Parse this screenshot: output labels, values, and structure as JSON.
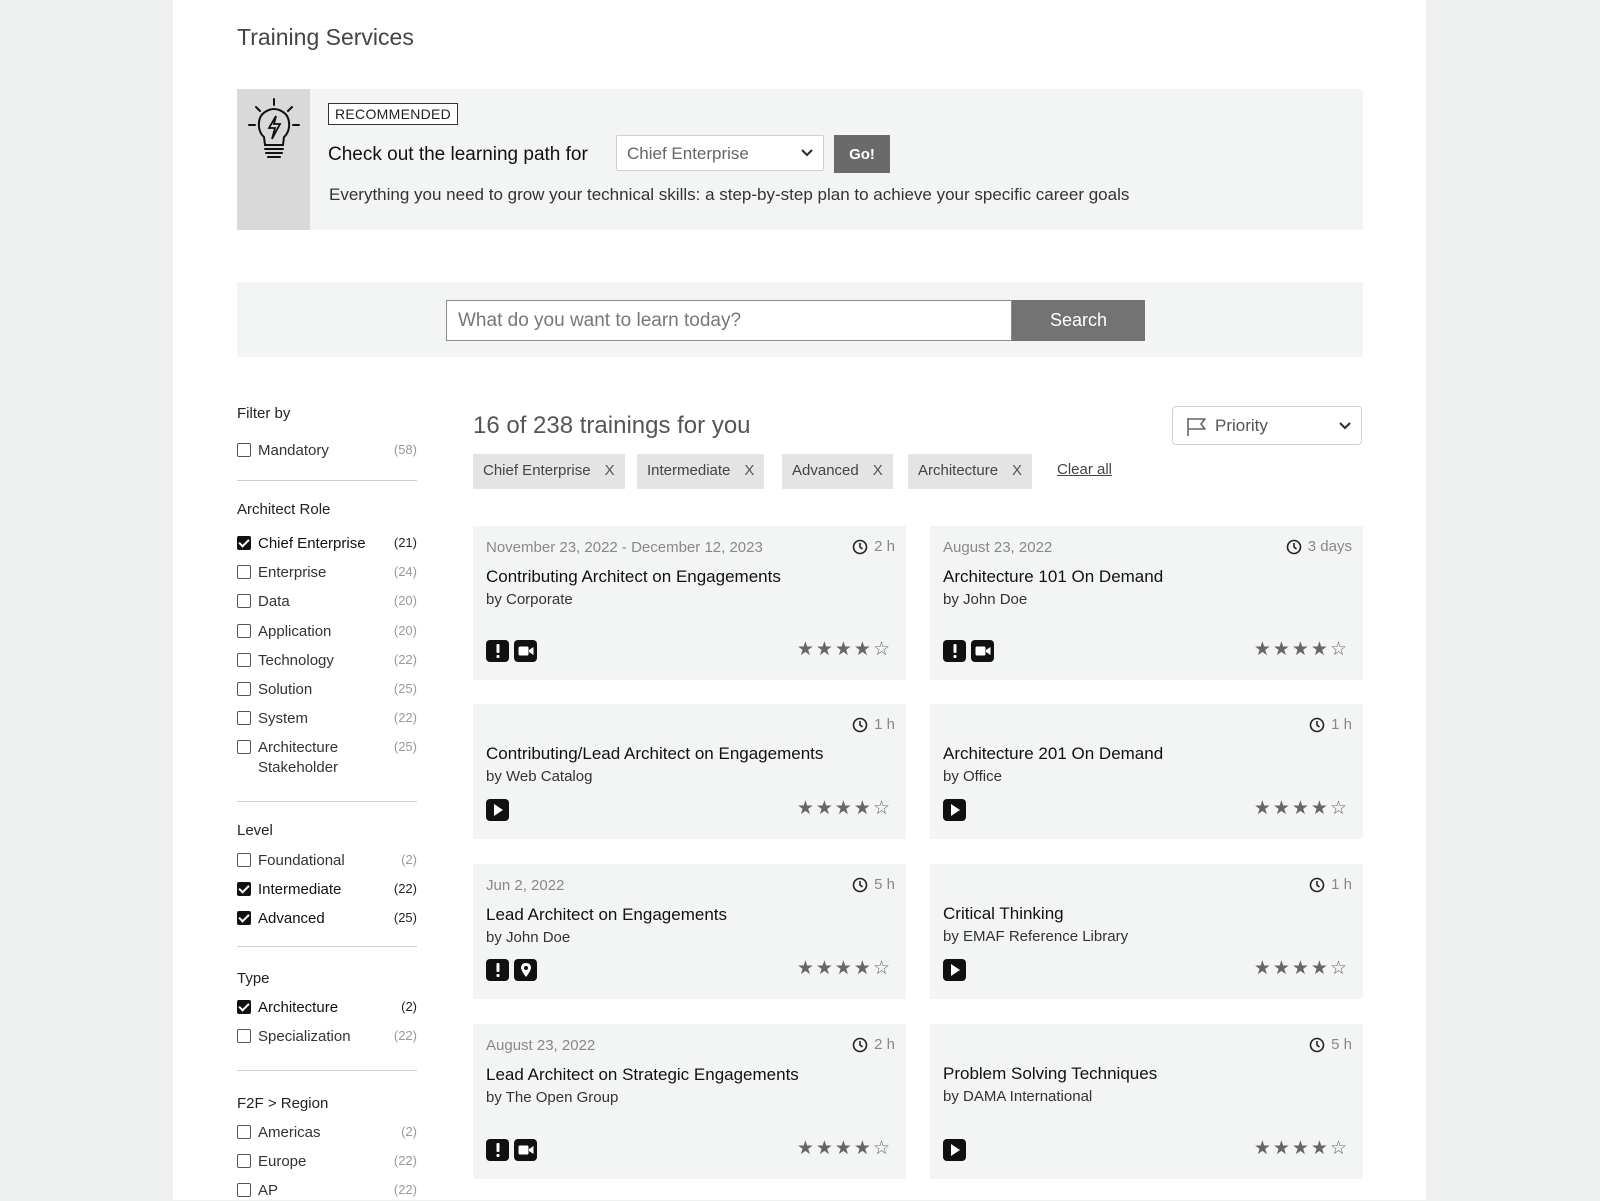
{
  "page_title": "Training Services",
  "banner": {
    "badge": "RECOMMENDED",
    "learning_path_text": "Check out the learning path for",
    "role_selected": "Chief Enterprise",
    "go_label": "Go!",
    "description": "Everything you need to grow your technical skills: a step-by-step plan to achieve your specific career goals"
  },
  "search": {
    "placeholder": "What do you want to learn today?",
    "button_label": "Search"
  },
  "filters": {
    "title": "Filter by",
    "mandatory": {
      "label": "Mandatory",
      "count": "(58)",
      "checked": false
    },
    "architect_role": {
      "title": "Architect Role",
      "items": [
        {
          "label": "Chief Enterprise",
          "count": "(21)",
          "checked": true
        },
        {
          "label": "Enterprise",
          "count": "(24)",
          "checked": false
        },
        {
          "label": "Data",
          "count": "(20)",
          "checked": false
        },
        {
          "label": "Application",
          "count": "(20)",
          "checked": false
        },
        {
          "label": "Technology",
          "count": "(22)",
          "checked": false
        },
        {
          "label": "Solution",
          "count": "(25)",
          "checked": false
        },
        {
          "label": "System",
          "count": "(22)",
          "checked": false
        },
        {
          "label": "Architecture Stakeholder",
          "count": "(25)",
          "checked": false
        }
      ]
    },
    "level": {
      "title": "Level",
      "items": [
        {
          "label": "Foundational",
          "count": "(2)",
          "checked": false
        },
        {
          "label": "Intermediate",
          "count": "(22)",
          "checked": true
        },
        {
          "label": "Advanced",
          "count": "(25)",
          "checked": true
        }
      ]
    },
    "type": {
      "title": "Type",
      "items": [
        {
          "label": "Architecture",
          "count": "(2)",
          "checked": true
        },
        {
          "label": "Specialization",
          "count": "(22)",
          "checked": false
        }
      ]
    },
    "region": {
      "title": "F2F > Region",
      "items": [
        {
          "label": "Americas",
          "count": "(2)",
          "checked": false
        },
        {
          "label": "Europe",
          "count": "(22)",
          "checked": false
        },
        {
          "label": "AP",
          "count": "(22)",
          "checked": false
        }
      ]
    }
  },
  "results": {
    "count_text": "16 of 238 trainings for you",
    "sort_label": "Priority",
    "chips": [
      "Chief Enterprise",
      "Intermediate",
      "Advanced",
      "Architecture"
    ],
    "chip_remove": "X",
    "clear_all": "Clear all"
  },
  "cards": [
    {
      "date": "November 23, 2022 - December 12, 2023",
      "duration": "2 h",
      "title": "Contributing Architect on Engagements",
      "author": "by Corporate",
      "icons": [
        "mandatory-icon",
        "video-icon"
      ],
      "rating": 4,
      "stars": "★★★★☆"
    },
    {
      "date": "August 23, 2022",
      "duration": "3 days",
      "title": "Architecture 101 On Demand",
      "author": "by John Doe",
      "icons": [
        "mandatory-icon",
        "video-icon"
      ],
      "rating": 4,
      "stars": "★★★★☆"
    },
    {
      "date": "",
      "duration": "1 h",
      "title": "Contributing/Lead Architect on Engagements",
      "author": "by Web Catalog",
      "icons": [
        "play-icon"
      ],
      "rating": 4,
      "stars": "★★★★☆"
    },
    {
      "date": "",
      "duration": "1 h",
      "title": "Architecture 201 On Demand",
      "author": "by Office",
      "icons": [
        "play-icon"
      ],
      "rating": 4,
      "stars": "★★★★☆"
    },
    {
      "date": "Jun 2, 2022",
      "duration": "5 h",
      "title": "Lead Architect on Engagements",
      "author": "by John Doe",
      "icons": [
        "mandatory-icon",
        "location-icon"
      ],
      "rating": 4,
      "stars": "★★★★☆"
    },
    {
      "date": "",
      "duration": "1 h",
      "title": "Critical Thinking",
      "author": "by EMAF Reference Library",
      "icons": [
        "play-icon"
      ],
      "rating": 4,
      "stars": "★★★★☆"
    },
    {
      "date": "August 23, 2022",
      "duration": "2 h",
      "title": "Lead Architect on Strategic Engagements",
      "author": "by The Open Group",
      "icons": [
        "mandatory-icon",
        "video-icon"
      ],
      "rating": 4,
      "stars": "★★★★☆"
    },
    {
      "date": "",
      "duration": "5 h",
      "title": "Problem Solving Techniques",
      "author": "by DAMA International",
      "icons": [
        "play-icon"
      ],
      "rating": 4,
      "stars": "★★★★☆"
    }
  ]
}
